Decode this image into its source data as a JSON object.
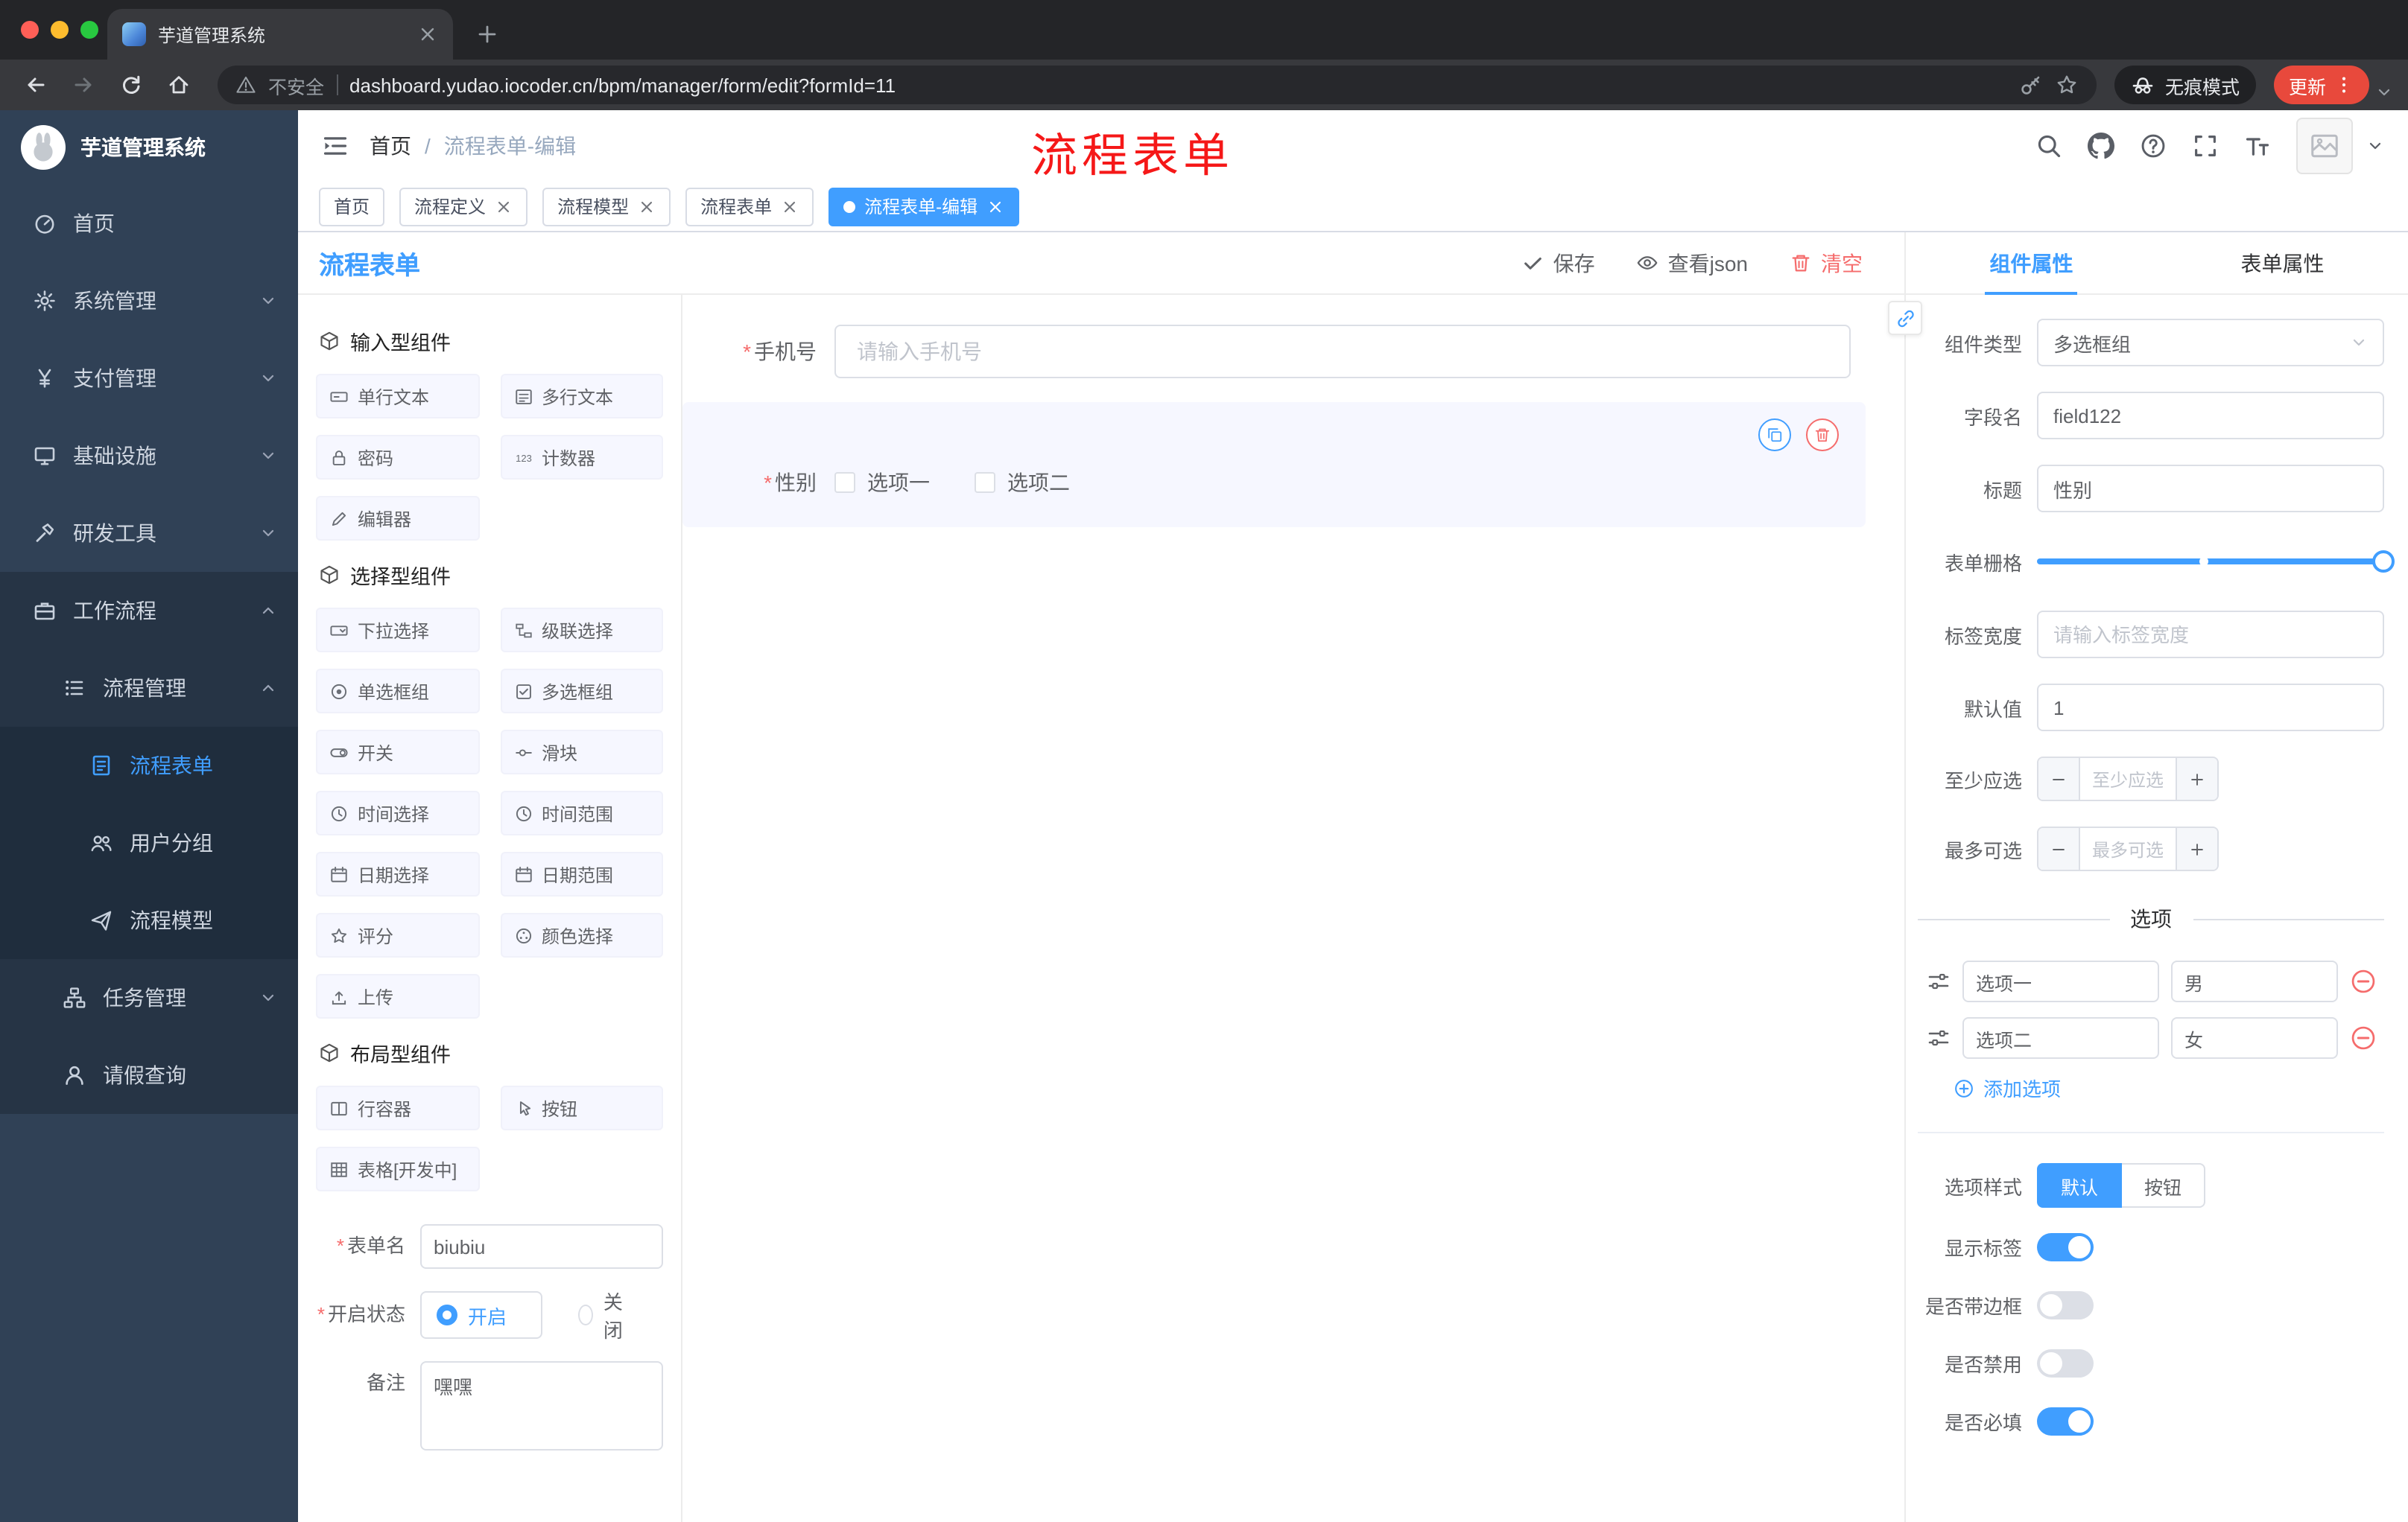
{
  "browser": {
    "tab_title": "芋道管理系统",
    "security_label": "不安全",
    "url": "dashboard.yudao.iocoder.cn/bpm/manager/form/edit?formId=11",
    "incognito_label": "无痕模式",
    "update_label": "更新"
  },
  "sidebar": {
    "app_title": "芋道管理系统",
    "items": {
      "home": "首页",
      "system": "系统管理",
      "payment": "支付管理",
      "infra": "基础设施",
      "devtools": "研发工具",
      "workflow": "工作流程",
      "process_mgmt": "流程管理",
      "process_form": "流程表单",
      "user_group": "用户分组",
      "process_model": "流程模型",
      "task_mgmt": "任务管理",
      "leave_query": "请假查询"
    }
  },
  "header": {
    "breadcrumb_home": "首页",
    "breadcrumb_sep": "/",
    "breadcrumb_current": "流程表单-编辑",
    "annotation": "流程表单"
  },
  "tags": [
    {
      "label": "首页"
    },
    {
      "label": "流程定义"
    },
    {
      "label": "流程模型"
    },
    {
      "label": "流程表单"
    },
    {
      "label": "流程表单-编辑"
    }
  ],
  "editor": {
    "title": "流程表单",
    "save": "保存",
    "view_json": "查看json",
    "clear": "清空",
    "groups": [
      {
        "title": "输入型组件",
        "items": [
          "单行文本",
          "多行文本",
          "密码",
          "计数器",
          "编辑器"
        ]
      },
      {
        "title": "选择型组件",
        "items": [
          "下拉选择",
          "级联选择",
          "单选框组",
          "多选框组",
          "开关",
          "滑块",
          "时间选择",
          "时间范围",
          "日期选择",
          "日期范围",
          "评分",
          "颜色选择",
          "上传"
        ]
      },
      {
        "title": "布局型组件",
        "items": [
          "行容器",
          "按钮",
          "表格[开发中]"
        ]
      }
    ],
    "meta": {
      "name_label": "表单名",
      "name_value": "biubiu",
      "status_label": "开启状态",
      "status_on": "开启",
      "status_off": "关闭",
      "remark_label": "备注",
      "remark_value": "嘿嘿"
    },
    "canvas": {
      "phone_label": "手机号",
      "phone_placeholder": "请输入手机号",
      "gender_label": "性别",
      "opt1": "选项一",
      "opt2": "选项二"
    }
  },
  "props": {
    "tab_component": "组件属性",
    "tab_form": "表单属性",
    "type_label": "组件类型",
    "type_value": "多选框组",
    "field_label": "字段名",
    "field_value": "field122",
    "title_label": "标题",
    "title_value": "性别",
    "grid_label": "表单栅格",
    "width_label": "标签宽度",
    "width_placeholder": "请输入标签宽度",
    "default_label": "默认值",
    "default_value": "1",
    "min_label": "至少应选",
    "min_placeholder": "至少应选",
    "max_label": "最多可选",
    "max_placeholder": "最多可选",
    "options_divider": "选项",
    "option_rows": [
      {
        "label": "选项一",
        "value": "男"
      },
      {
        "label": "选项二",
        "value": "女"
      }
    ],
    "add_option": "添加选项",
    "style_label": "选项样式",
    "style_default": "默认",
    "style_button": "按钮",
    "switch_show_label": "显示标签",
    "switch_border": "是否带边框",
    "switch_disabled": "是否禁用",
    "switch_required": "是否必填"
  },
  "icons": {
    "save": "check",
    "view_json": "eye",
    "clear": "trash",
    "copy": "copy",
    "delete": "trash",
    "add_option": "circle-plus",
    "remove_option": "circle-minus",
    "drag_handle": "operation-sliders",
    "component_group": "cube"
  },
  "colors": {
    "accent": "#409eff",
    "danger": "#f56c6c",
    "sidebar_bg": "#304156",
    "active_tag": "#409eff",
    "annotation_red": "#f51818"
  }
}
